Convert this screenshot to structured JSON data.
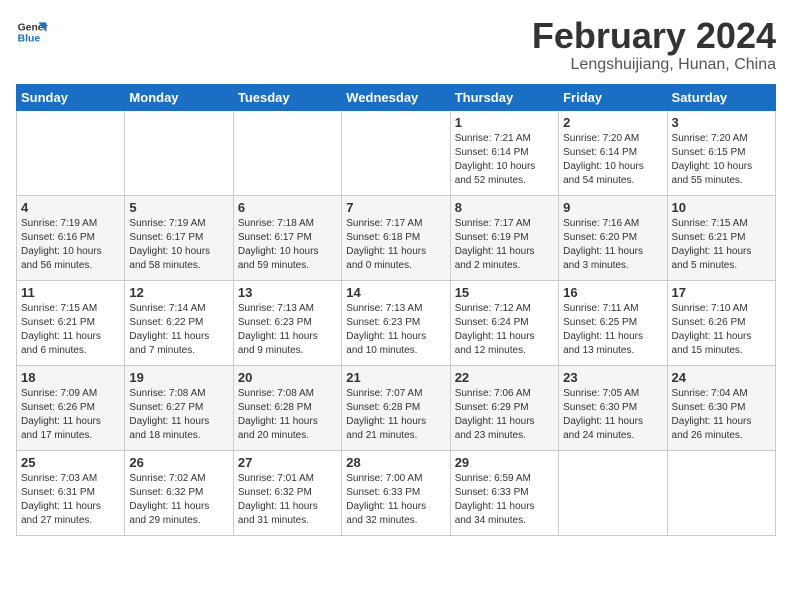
{
  "logo": {
    "line1": "General",
    "line2": "Blue"
  },
  "title": "February 2024",
  "subtitle": "Lengshuijiang, Hunan, China",
  "weekdays": [
    "Sunday",
    "Monday",
    "Tuesday",
    "Wednesday",
    "Thursday",
    "Friday",
    "Saturday"
  ],
  "weeks": [
    [
      {
        "day": "",
        "info": ""
      },
      {
        "day": "",
        "info": ""
      },
      {
        "day": "",
        "info": ""
      },
      {
        "day": "",
        "info": ""
      },
      {
        "day": "1",
        "info": "Sunrise: 7:21 AM\nSunset: 6:14 PM\nDaylight: 10 hours\nand 52 minutes."
      },
      {
        "day": "2",
        "info": "Sunrise: 7:20 AM\nSunset: 6:14 PM\nDaylight: 10 hours\nand 54 minutes."
      },
      {
        "day": "3",
        "info": "Sunrise: 7:20 AM\nSunset: 6:15 PM\nDaylight: 10 hours\nand 55 minutes."
      }
    ],
    [
      {
        "day": "4",
        "info": "Sunrise: 7:19 AM\nSunset: 6:16 PM\nDaylight: 10 hours\nand 56 minutes."
      },
      {
        "day": "5",
        "info": "Sunrise: 7:19 AM\nSunset: 6:17 PM\nDaylight: 10 hours\nand 58 minutes."
      },
      {
        "day": "6",
        "info": "Sunrise: 7:18 AM\nSunset: 6:17 PM\nDaylight: 10 hours\nand 59 minutes."
      },
      {
        "day": "7",
        "info": "Sunrise: 7:17 AM\nSunset: 6:18 PM\nDaylight: 11 hours\nand 0 minutes."
      },
      {
        "day": "8",
        "info": "Sunrise: 7:17 AM\nSunset: 6:19 PM\nDaylight: 11 hours\nand 2 minutes."
      },
      {
        "day": "9",
        "info": "Sunrise: 7:16 AM\nSunset: 6:20 PM\nDaylight: 11 hours\nand 3 minutes."
      },
      {
        "day": "10",
        "info": "Sunrise: 7:15 AM\nSunset: 6:21 PM\nDaylight: 11 hours\nand 5 minutes."
      }
    ],
    [
      {
        "day": "11",
        "info": "Sunrise: 7:15 AM\nSunset: 6:21 PM\nDaylight: 11 hours\nand 6 minutes."
      },
      {
        "day": "12",
        "info": "Sunrise: 7:14 AM\nSunset: 6:22 PM\nDaylight: 11 hours\nand 7 minutes."
      },
      {
        "day": "13",
        "info": "Sunrise: 7:13 AM\nSunset: 6:23 PM\nDaylight: 11 hours\nand 9 minutes."
      },
      {
        "day": "14",
        "info": "Sunrise: 7:13 AM\nSunset: 6:23 PM\nDaylight: 11 hours\nand 10 minutes."
      },
      {
        "day": "15",
        "info": "Sunrise: 7:12 AM\nSunset: 6:24 PM\nDaylight: 11 hours\nand 12 minutes."
      },
      {
        "day": "16",
        "info": "Sunrise: 7:11 AM\nSunset: 6:25 PM\nDaylight: 11 hours\nand 13 minutes."
      },
      {
        "day": "17",
        "info": "Sunrise: 7:10 AM\nSunset: 6:26 PM\nDaylight: 11 hours\nand 15 minutes."
      }
    ],
    [
      {
        "day": "18",
        "info": "Sunrise: 7:09 AM\nSunset: 6:26 PM\nDaylight: 11 hours\nand 17 minutes."
      },
      {
        "day": "19",
        "info": "Sunrise: 7:08 AM\nSunset: 6:27 PM\nDaylight: 11 hours\nand 18 minutes."
      },
      {
        "day": "20",
        "info": "Sunrise: 7:08 AM\nSunset: 6:28 PM\nDaylight: 11 hours\nand 20 minutes."
      },
      {
        "day": "21",
        "info": "Sunrise: 7:07 AM\nSunset: 6:28 PM\nDaylight: 11 hours\nand 21 minutes."
      },
      {
        "day": "22",
        "info": "Sunrise: 7:06 AM\nSunset: 6:29 PM\nDaylight: 11 hours\nand 23 minutes."
      },
      {
        "day": "23",
        "info": "Sunrise: 7:05 AM\nSunset: 6:30 PM\nDaylight: 11 hours\nand 24 minutes."
      },
      {
        "day": "24",
        "info": "Sunrise: 7:04 AM\nSunset: 6:30 PM\nDaylight: 11 hours\nand 26 minutes."
      }
    ],
    [
      {
        "day": "25",
        "info": "Sunrise: 7:03 AM\nSunset: 6:31 PM\nDaylight: 11 hours\nand 27 minutes."
      },
      {
        "day": "26",
        "info": "Sunrise: 7:02 AM\nSunset: 6:32 PM\nDaylight: 11 hours\nand 29 minutes."
      },
      {
        "day": "27",
        "info": "Sunrise: 7:01 AM\nSunset: 6:32 PM\nDaylight: 11 hours\nand 31 minutes."
      },
      {
        "day": "28",
        "info": "Sunrise: 7:00 AM\nSunset: 6:33 PM\nDaylight: 11 hours\nand 32 minutes."
      },
      {
        "day": "29",
        "info": "Sunrise: 6:59 AM\nSunset: 6:33 PM\nDaylight: 11 hours\nand 34 minutes."
      },
      {
        "day": "",
        "info": ""
      },
      {
        "day": "",
        "info": ""
      }
    ]
  ]
}
